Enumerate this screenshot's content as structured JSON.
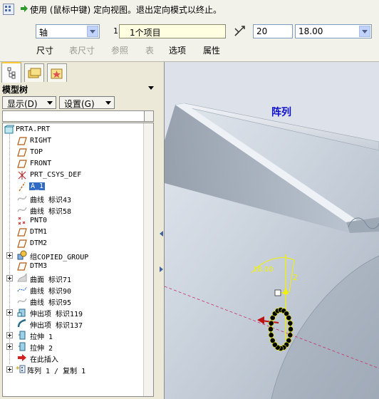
{
  "dashboard": {
    "message": "使用 (鼠标中键) 定向视图。退出定向模式以终止。",
    "ref_type": "轴",
    "ref_index": "1",
    "ref_collector": "1个项目",
    "angle_value": "20",
    "dimension_value": "18.00",
    "tabs": [
      "尺寸",
      "表尺寸",
      "参照",
      "表",
      "选项",
      "属性"
    ]
  },
  "model_tree": {
    "title": "模型树",
    "show_button": "显示(D)",
    "settings_button": "设置(G)",
    "items": [
      {
        "label": "PRTA.PRT",
        "icon": "part-icon"
      },
      {
        "label": "RIGHT",
        "icon": "datum-plane-icon"
      },
      {
        "label": "TOP",
        "icon": "datum-plane-icon"
      },
      {
        "label": "FRONT",
        "icon": "datum-plane-icon"
      },
      {
        "label": "PRT_CSYS_DEF",
        "icon": "csys-icon"
      },
      {
        "label": "A_1",
        "icon": "datum-axis-icon"
      },
      {
        "label": "曲线 标识43",
        "icon": "curve-icon"
      },
      {
        "label": "曲线 标识58",
        "icon": "curve-icon"
      },
      {
        "label": "PNT0",
        "icon": "datum-point-icon"
      },
      {
        "label": "DTM1",
        "icon": "datum-plane-icon"
      },
      {
        "label": "DTM2",
        "icon": "datum-plane-icon"
      },
      {
        "label": "组COPIED_GROUP",
        "icon": "group-icon"
      },
      {
        "label": "DTM3",
        "icon": "datum-plane-icon"
      },
      {
        "label": "曲面 标识71",
        "icon": "surface-icon"
      },
      {
        "label": "曲线 标识90",
        "icon": "curve-icon"
      },
      {
        "label": "曲线 标识95",
        "icon": "curve-icon"
      },
      {
        "label": "伸出项 标识119",
        "icon": "protrusion-icon"
      },
      {
        "label": "伸出项 标识137",
        "icon": "sweep-icon"
      },
      {
        "label": "拉伸 1",
        "icon": "extrude-icon"
      },
      {
        "label": "拉伸 2",
        "icon": "extrude-icon"
      },
      {
        "label": "在此插入",
        "icon": "insert-here-icon"
      },
      {
        "label": "阵列 1 / 复制 1",
        "icon": "pattern-icon"
      }
    ]
  },
  "viewport": {
    "label": "阵列",
    "dim_angle": "18.00",
    "dim_count": "2"
  },
  "colors": {
    "selection": "#316ac5",
    "viewport_label": "#1010c8",
    "dimension": "#f2f200",
    "model_face": "#c9d2dc"
  }
}
